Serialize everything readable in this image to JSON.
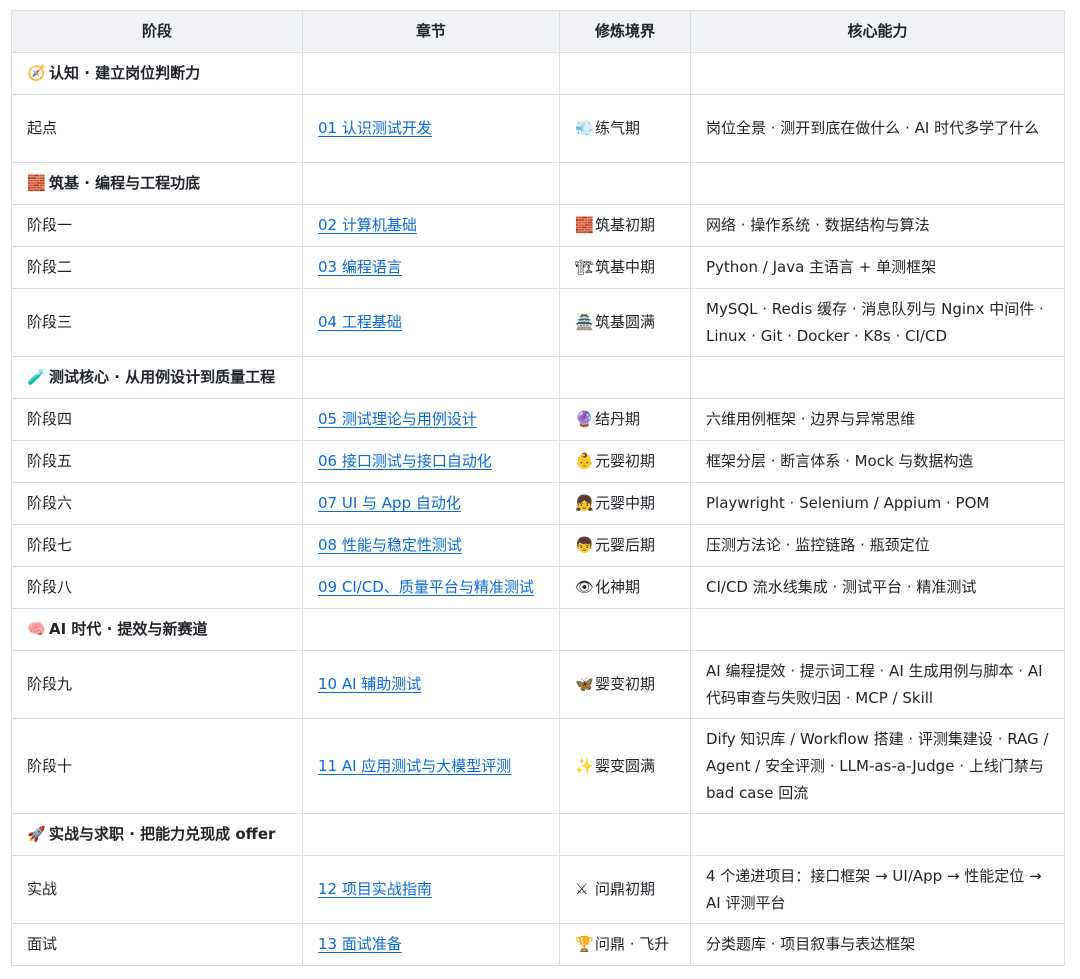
{
  "headers": [
    "阶段",
    "章节",
    "修炼境界",
    "核心能力"
  ],
  "sections": [
    {
      "icon": "🧭",
      "title": "认知 · 建立岗位判断力",
      "rows": [
        {
          "stage": "起点",
          "chapter": "01 认识测试开发",
          "realm_icon": "💨",
          "realm": "练气期",
          "ability": "岗位全景 · 测开到底在做什么 · AI 时代多学了什么",
          "height": "tall"
        }
      ]
    },
    {
      "icon": "🧱",
      "title": "筑基 · 编程与工程功底",
      "rows": [
        {
          "stage": "阶段一",
          "chapter": "02 计算机基础",
          "realm_icon": "🧱",
          "realm": "筑基初期",
          "ability": "网络 · 操作系统 · 数据结构与算法",
          "height": ""
        },
        {
          "stage": "阶段二",
          "chapter": "03 编程语言",
          "realm_icon": "🏗",
          "realm": "筑基中期",
          "ability": "Python / Java 主语言 + 单测框架",
          "height": ""
        },
        {
          "stage": "阶段三",
          "chapter": "04 工程基础",
          "realm_icon": "🏯",
          "realm": "筑基圆满",
          "ability": "MySQL · Redis 缓存 · 消息队列与 Nginx 中间件 · Linux · Git · Docker · K8s · CI/CD",
          "height": "tall"
        }
      ]
    },
    {
      "icon": "🧪",
      "title": "测试核心 · 从用例设计到质量工程",
      "rows": [
        {
          "stage": "阶段四",
          "chapter": "05 测试理论与用例设计",
          "realm_icon": "🔮",
          "realm": "结丹期",
          "ability": "六维用例框架 · 边界与异常思维",
          "height": ""
        },
        {
          "stage": "阶段五",
          "chapter": "06 接口测试与接口自动化",
          "realm_icon": "👶",
          "realm": "元婴初期",
          "ability": "框架分层 · 断言体系 · Mock 与数据构造",
          "height": ""
        },
        {
          "stage": "阶段六",
          "chapter": "07 UI 与 App 自动化",
          "realm_icon": "👧",
          "realm": "元婴中期",
          "ability": "Playwright · Selenium / Appium · POM",
          "height": ""
        },
        {
          "stage": "阶段七",
          "chapter": "08 性能与稳定性测试",
          "realm_icon": "👦",
          "realm": "元婴后期",
          "ability": "压测方法论 · 监控链路 · 瓶颈定位",
          "height": ""
        },
        {
          "stage": "阶段八",
          "chapter": "09 CI/CD、质量平台与精准测试",
          "realm_icon": "👁",
          "realm": "化神期",
          "ability": "CI/CD 流水线集成 · 测试平台 · 精准测试",
          "height": ""
        }
      ]
    },
    {
      "icon": "🧠",
      "title": "AI 时代 · 提效与新赛道",
      "rows": [
        {
          "stage": "阶段九",
          "chapter": "10 AI 辅助测试",
          "realm_icon": "🦋",
          "realm": "婴变初期",
          "ability": "AI 编程提效 · 提示词工程 · AI 生成用例与脚本 · AI 代码审查与失败归因 · MCP / Skill",
          "height": "tall"
        },
        {
          "stage": "阶段十",
          "chapter": "11 AI 应用测试与大模型评测",
          "realm_icon": "✨",
          "realm": "婴变圆满",
          "ability": "Dify 知识库 / Workflow 搭建 · 评测集建设 · RAG / Agent / 安全评测 · LLM-as-a-Judge · 上线门禁与 bad case 回流",
          "height": "xtall"
        }
      ]
    },
    {
      "icon": "🚀",
      "title": "实战与求职 · 把能力兑现成 offer",
      "rows": [
        {
          "stage": "实战",
          "chapter": "12 项目实战指南",
          "realm_icon": "⚔",
          "realm": "问鼎初期",
          "ability": "4 个递进项目：接口框架 → UI/App → 性能定位 → AI 评测平台",
          "height": "tall"
        },
        {
          "stage": "面试",
          "chapter": "13 面试准备",
          "realm_icon": "🏆",
          "realm": "问鼎 · 飞升",
          "ability": "分类题库 · 项目叙事与表达框架",
          "height": ""
        }
      ]
    }
  ],
  "colors": {
    "link": "#0969da",
    "header_bg": "#f0f2f5",
    "border": "#d8dee4"
  }
}
